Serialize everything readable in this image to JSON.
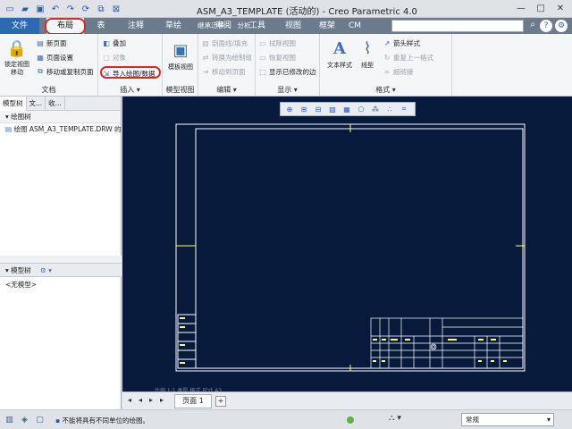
{
  "window": {
    "title": "ASM_A3_TEMPLATE (活动的) - Creo Parametric 4.0",
    "minimize": "—",
    "maximize": "□",
    "close": "✕"
  },
  "tabs": [
    {
      "label": "文件"
    },
    {
      "label": "布局"
    },
    {
      "label": "表"
    },
    {
      "label": "注释"
    },
    {
      "label": "草绘"
    },
    {
      "label": "继承迁移"
    },
    {
      "label": "分析"
    },
    {
      "label": "审阅"
    },
    {
      "label": "工具"
    },
    {
      "label": "视图"
    },
    {
      "label": "框架"
    },
    {
      "label": "CM"
    }
  ],
  "ribbon": {
    "document": {
      "label": "文档",
      "lock_view_move": "锁定视图移动",
      "new_page": "新页面",
      "page_setup": "页面设置",
      "move_copy_page": "移动或复制页面"
    },
    "insert": {
      "label": "插入 ▾",
      "overlay": "叠加",
      "object": "对象",
      "import_drawing": "导入绘图/数据"
    },
    "model_views": {
      "label": "模型视图",
      "general_view": "模板视图"
    },
    "edit": {
      "label": "编辑 ▾",
      "section_fill": "剖面线/填充",
      "convert_to_sketch": "转换为绘制组",
      "move_to_page": "移动到页面"
    },
    "display": {
      "label": "显示 ▾",
      "reset_view": "拭除视图",
      "show_view": "恢复视图",
      "show_modified": "显示已修改的边"
    },
    "format": {
      "label": "格式 ▾",
      "text_style": "文本样式",
      "line_style": "线型",
      "arrow_style": "箭头样式",
      "repeat_format": "重复上一格式",
      "hyperlink": "超链接"
    }
  },
  "left_panel": {
    "tab_model_tree": "模型树",
    "tab_folder": "文...",
    "tab_favorites": "收...",
    "drawing_tree_header": "绘图树",
    "drawing_item": "绘图 ASM_A3_TEMPLATE.DRW 的页",
    "model_tree_header": "模型树",
    "no_model": "<无模型>"
  },
  "graphics": {
    "sheet_info": "比例 1:1   类型 格式   尺寸 A3"
  },
  "page_bar": {
    "page_tab": "页面 1",
    "add": "+"
  },
  "status": {
    "message": "不能将具有不同单位的绘图。",
    "filter_value": "常规"
  },
  "colors": {
    "graphics_bg": "#071a3c",
    "border_line": "#ffffff",
    "title_block": "#ffff66",
    "highlight": "#d42a2a"
  }
}
